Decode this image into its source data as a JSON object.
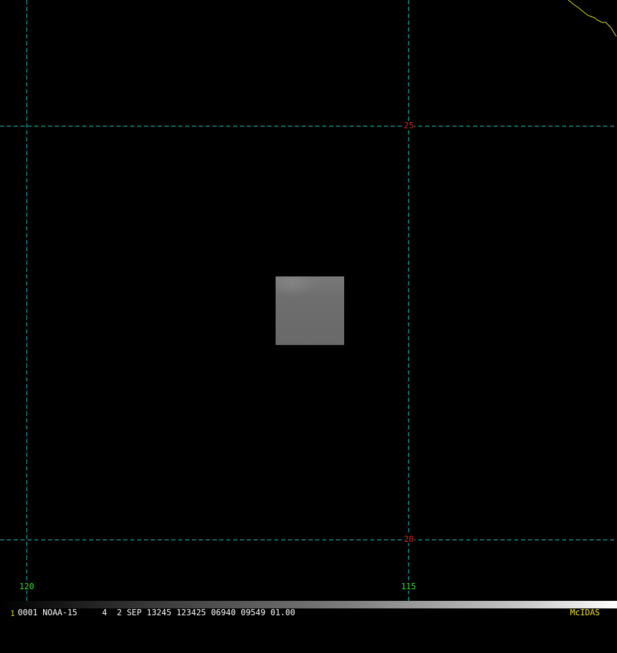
{
  "map": {
    "latitude_labels": [
      "25",
      "20"
    ],
    "longitude_labels": [
      "120",
      "115"
    ],
    "grid_line_color": "#22d3d3",
    "coastline_color": "#e8e820",
    "latitude_label_color": "#e0201f",
    "longitude_label_color": "#2fe02f"
  },
  "status": {
    "frame_number": "1",
    "image_info": "0001 NOAA-15     4  2 SEP 13245 123425 06940 09549 01.00",
    "brand": "McIDAS"
  }
}
